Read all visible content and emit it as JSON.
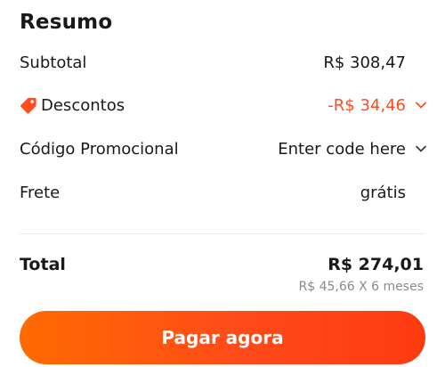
{
  "summary": {
    "title": "Resumo",
    "subtotal_label": "Subtotal",
    "subtotal_value": "R$ 308,47",
    "discounts_label": "Descontos",
    "discounts_value": "-R$ 34,46",
    "promo_label": "Código Promocional",
    "promo_placeholder": "Enter code here",
    "shipping_label": "Frete",
    "shipping_value": "grátis",
    "total_label": "Total",
    "total_value": "R$ 274,01",
    "installments": "R$ 45,66 X 6 meses"
  },
  "actions": {
    "pay_label": "Pagar agora"
  },
  "colors": {
    "accent": "#ff4b1f",
    "button_start": "#ff6a00",
    "button_end": "#ff3a10"
  }
}
